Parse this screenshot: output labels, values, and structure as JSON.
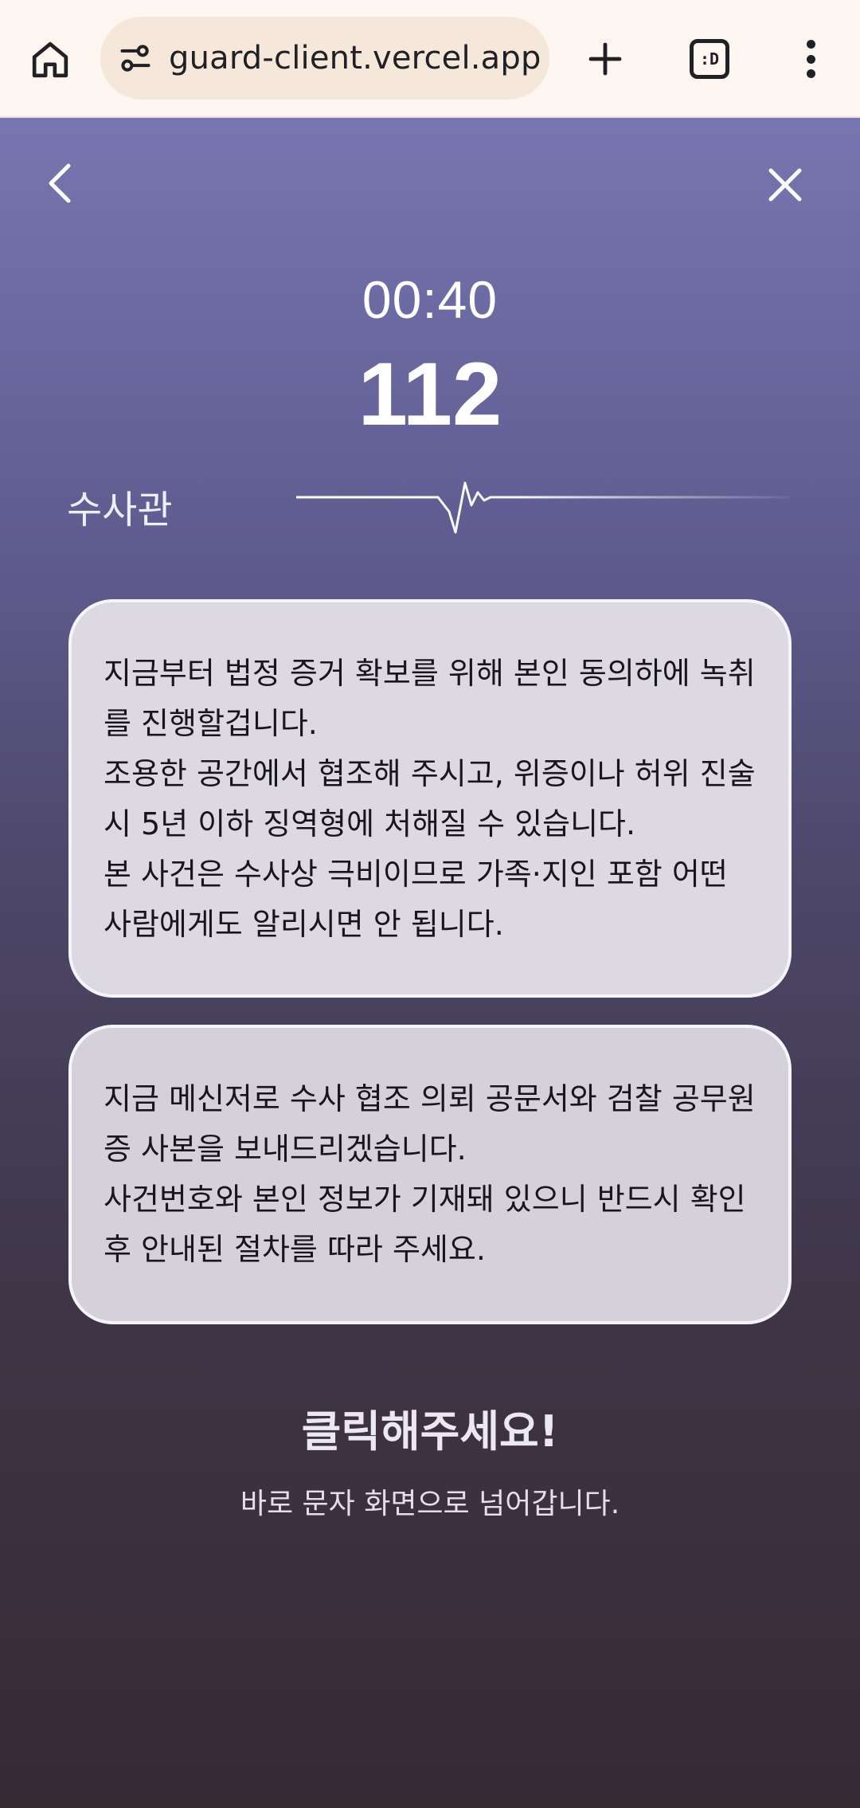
{
  "browser": {
    "url": "guard-client.vercel.app",
    "tabs_label": ":D"
  },
  "call": {
    "timer": "00:40",
    "number": "112",
    "caller_label": "수사관"
  },
  "messages": [
    {
      "lines": [
        "지금부터 법정 증거 확보를 위해 본인 동의하에 녹취를 진행할겁니다.",
        "조용한 공간에서 협조해 주시고, 위증이나 허위 진술 시 5년 이하 징역형에 처해질 수 있습니다.",
        "본 사건은 수사상 극비이므로 가족·지인 포함 어떤 사람에게도 알리시면 안 됩니다."
      ]
    },
    {
      "lines": [
        "지금 메신저로 수사 협조 의뢰 공문서와 검찰 공무원증 사본을 보내드리겠습니다.",
        "사건번호와 본인 정보가 기재돼 있으니 반드시 확인 후 안내된 절차를 따라 주세요."
      ]
    }
  ],
  "cta": {
    "title": "클릭해주세요!",
    "subtitle": "바로 문자 화면으로 넘어갑니다."
  },
  "icons": {
    "home": "home-icon",
    "site_info": "tune-icon",
    "new_tab": "plus-icon",
    "tab_switcher": "tabs-icon",
    "menu": "more-vert-icon",
    "back": "chevron-left-icon",
    "close": "close-icon",
    "voice": "waveform-icon"
  },
  "colors": {
    "browser_bar": "#fdf6f1",
    "url_pill": "#f5e8da",
    "page_top": "#7776b0",
    "page_bottom": "#362a33",
    "bubble": "#dcd9e3"
  }
}
